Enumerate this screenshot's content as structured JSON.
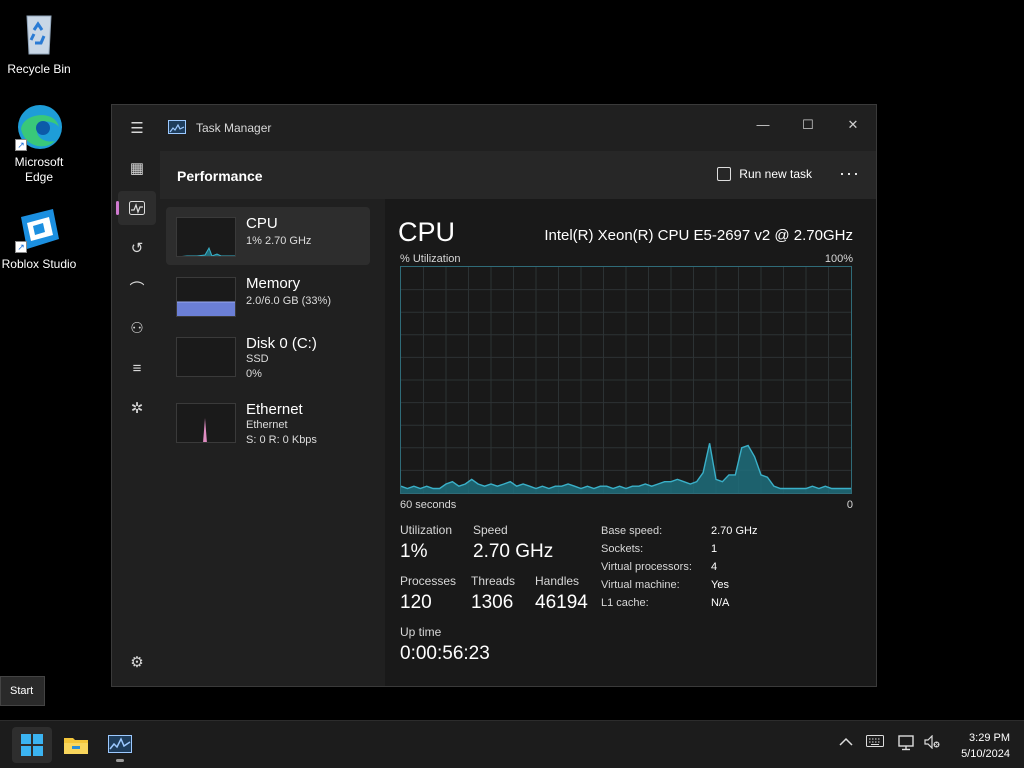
{
  "desktop": {
    "icons": [
      {
        "label": "Recycle Bin"
      },
      {
        "label": "Microsoft Edge"
      },
      {
        "label": "Roblox Studio"
      }
    ]
  },
  "window": {
    "title": "Task Manager",
    "controls": {
      "minimize": "—",
      "maximize": "☐",
      "close": "✕"
    }
  },
  "nav": {
    "items": [
      {
        "icon": "hamburger-menu-icon",
        "glyph": "☰"
      },
      {
        "icon": "processes-icon",
        "glyph": "▦"
      },
      {
        "icon": "performance-icon",
        "glyph": "⌁",
        "active": true
      },
      {
        "icon": "app-history-icon",
        "glyph": "↺"
      },
      {
        "icon": "startup-apps-icon",
        "glyph": "⌒"
      },
      {
        "icon": "users-icon",
        "glyph": "⚇"
      },
      {
        "icon": "details-icon",
        "glyph": "≡"
      },
      {
        "icon": "services-icon",
        "glyph": "✲"
      },
      {
        "icon": "settings-icon",
        "glyph": "⚙"
      }
    ]
  },
  "header": {
    "page_title": "Performance",
    "run_new_task": "Run new task",
    "more": "···"
  },
  "resources": [
    {
      "name": "CPU",
      "sub1": "1% 2.70 GHz",
      "sub2": ""
    },
    {
      "name": "Memory",
      "sub1": "2.0/6.0 GB (33%)",
      "sub2": ""
    },
    {
      "name": "Disk 0 (C:)",
      "sub1": "SSD",
      "sub2": "0%"
    },
    {
      "name": "Ethernet",
      "sub1": "Ethernet",
      "sub2": "S: 0 R: 0 Kbps"
    }
  ],
  "cpu": {
    "title": "CPU",
    "model": "Intel(R) Xeon(R) CPU E5-2697 v2 @ 2.70GHz",
    "graph_label": "% Utilization",
    "graph_max": "100%",
    "graph_span": "60 seconds",
    "graph_min": "0",
    "utilization_history": [
      3,
      2,
      3,
      2,
      3,
      2,
      2,
      4,
      5,
      3,
      4,
      6,
      4,
      3,
      4,
      3,
      4,
      5,
      3,
      4,
      3,
      2,
      3,
      2,
      3,
      3,
      4,
      3,
      2,
      3,
      2,
      3,
      3,
      2,
      3,
      2,
      3,
      3,
      4,
      3,
      4,
      5,
      5,
      6,
      5,
      4,
      5,
      9,
      22,
      6,
      5,
      8,
      8,
      20,
      21,
      16,
      8,
      7,
      3,
      2,
      2,
      2,
      2,
      2,
      3,
      2,
      3,
      2,
      2,
      2,
      2
    ],
    "stats": {
      "utilization_label": "Utilization",
      "utilization": "1%",
      "speed_label": "Speed",
      "speed": "2.70 GHz",
      "processes_label": "Processes",
      "processes": "120",
      "threads_label": "Threads",
      "threads": "1306",
      "handles_label": "Handles",
      "handles": "46194",
      "uptime_label": "Up time",
      "uptime": "0:00:56:23"
    },
    "details": [
      {
        "key": "Base speed:",
        "value": "2.70 GHz"
      },
      {
        "key": "Sockets:",
        "value": "1"
      },
      {
        "key": "Virtual processors:",
        "value": "4"
      },
      {
        "key": "Virtual machine:",
        "value": "Yes"
      },
      {
        "key": "L1 cache:",
        "value": "N/A"
      }
    ]
  },
  "taskbar": {
    "start_tooltip": "Start",
    "time": "3:29 PM",
    "date": "5/10/2024"
  },
  "colors": {
    "accent": "#3ab0c8",
    "memory": "#6b7fd6",
    "ethernet": "#e08cc2",
    "nav_indicator": "#d07ad0"
  }
}
